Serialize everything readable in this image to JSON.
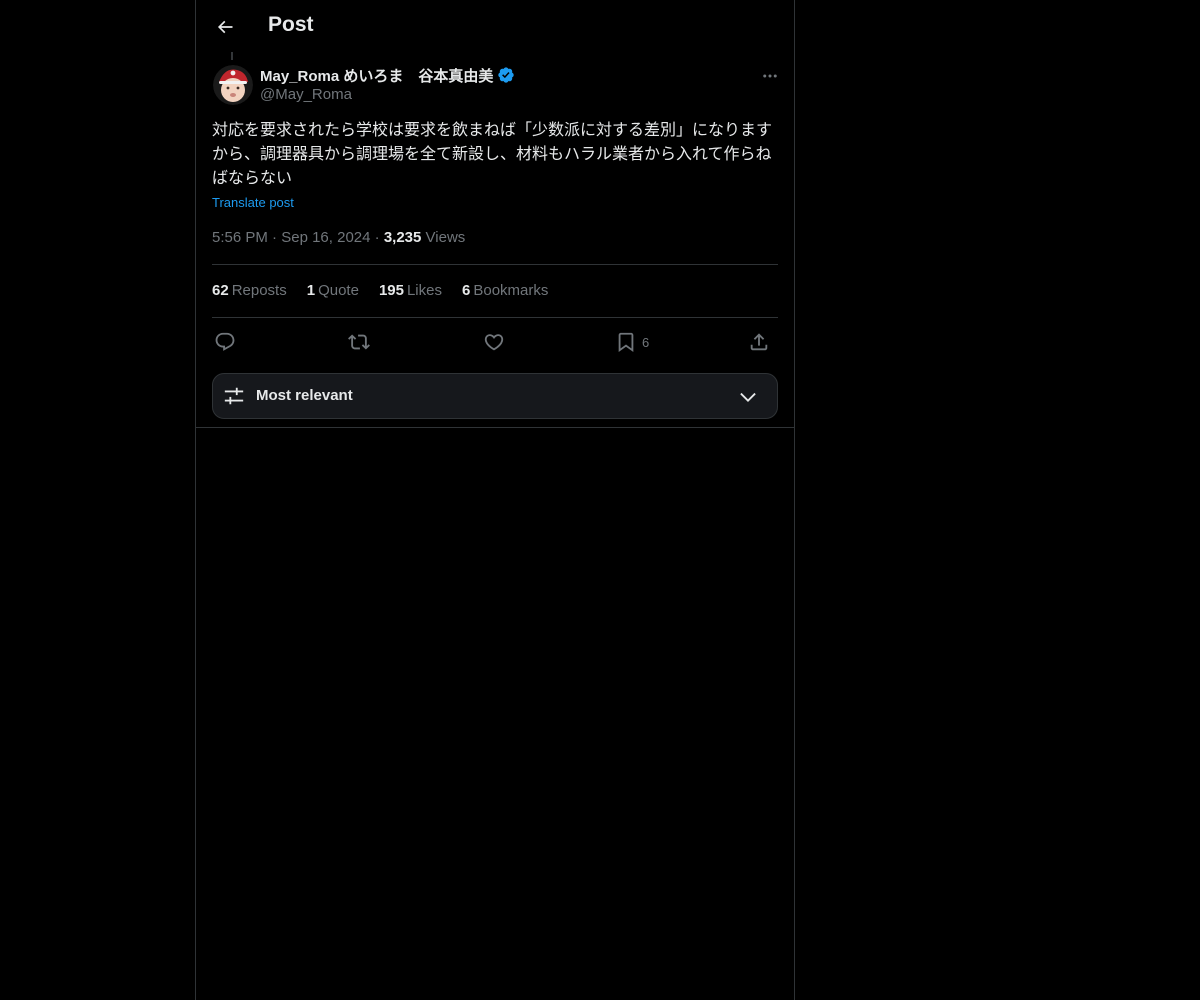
{
  "header": {
    "title": "Post"
  },
  "post": {
    "author_name": "May_Roma めいろま　谷本真由美",
    "handle": "@May_Roma",
    "text": "対応を要求されたら学校は要求を飲まねば「少数派に対する差別」になりますから、調理器具から調理場を全て新設し、材料もハラル業者から入れて作らねばならない",
    "translate_label": "Translate post",
    "time": "5:56 PM",
    "date": "Sep 16, 2024",
    "views_count": "3,235",
    "views_label": "Views"
  },
  "stats": {
    "reposts_count": "62",
    "reposts_label": "Reposts",
    "quotes_count": "1",
    "quotes_label": "Quote",
    "likes_count": "195",
    "likes_label": "Likes",
    "bookmarks_count": "6",
    "bookmarks_label": "Bookmarks"
  },
  "actions": {
    "bookmark_count": "6"
  },
  "sort": {
    "label": "Most relevant"
  },
  "icons": {
    "back": "arrow-left-icon",
    "verified": "verified-badge-icon",
    "more": "more-horizontal-icon",
    "reply": "reply-icon",
    "repost": "repost-icon",
    "like": "heart-icon",
    "bookmark": "bookmark-icon",
    "share": "share-icon",
    "sort": "sliders-icon",
    "chevron": "chevron-down-icon"
  },
  "colors": {
    "background": "#000000",
    "text": "#e7e9ea",
    "secondary": "#71767b",
    "accent": "#1d9bf0",
    "border": "#2f3336"
  }
}
